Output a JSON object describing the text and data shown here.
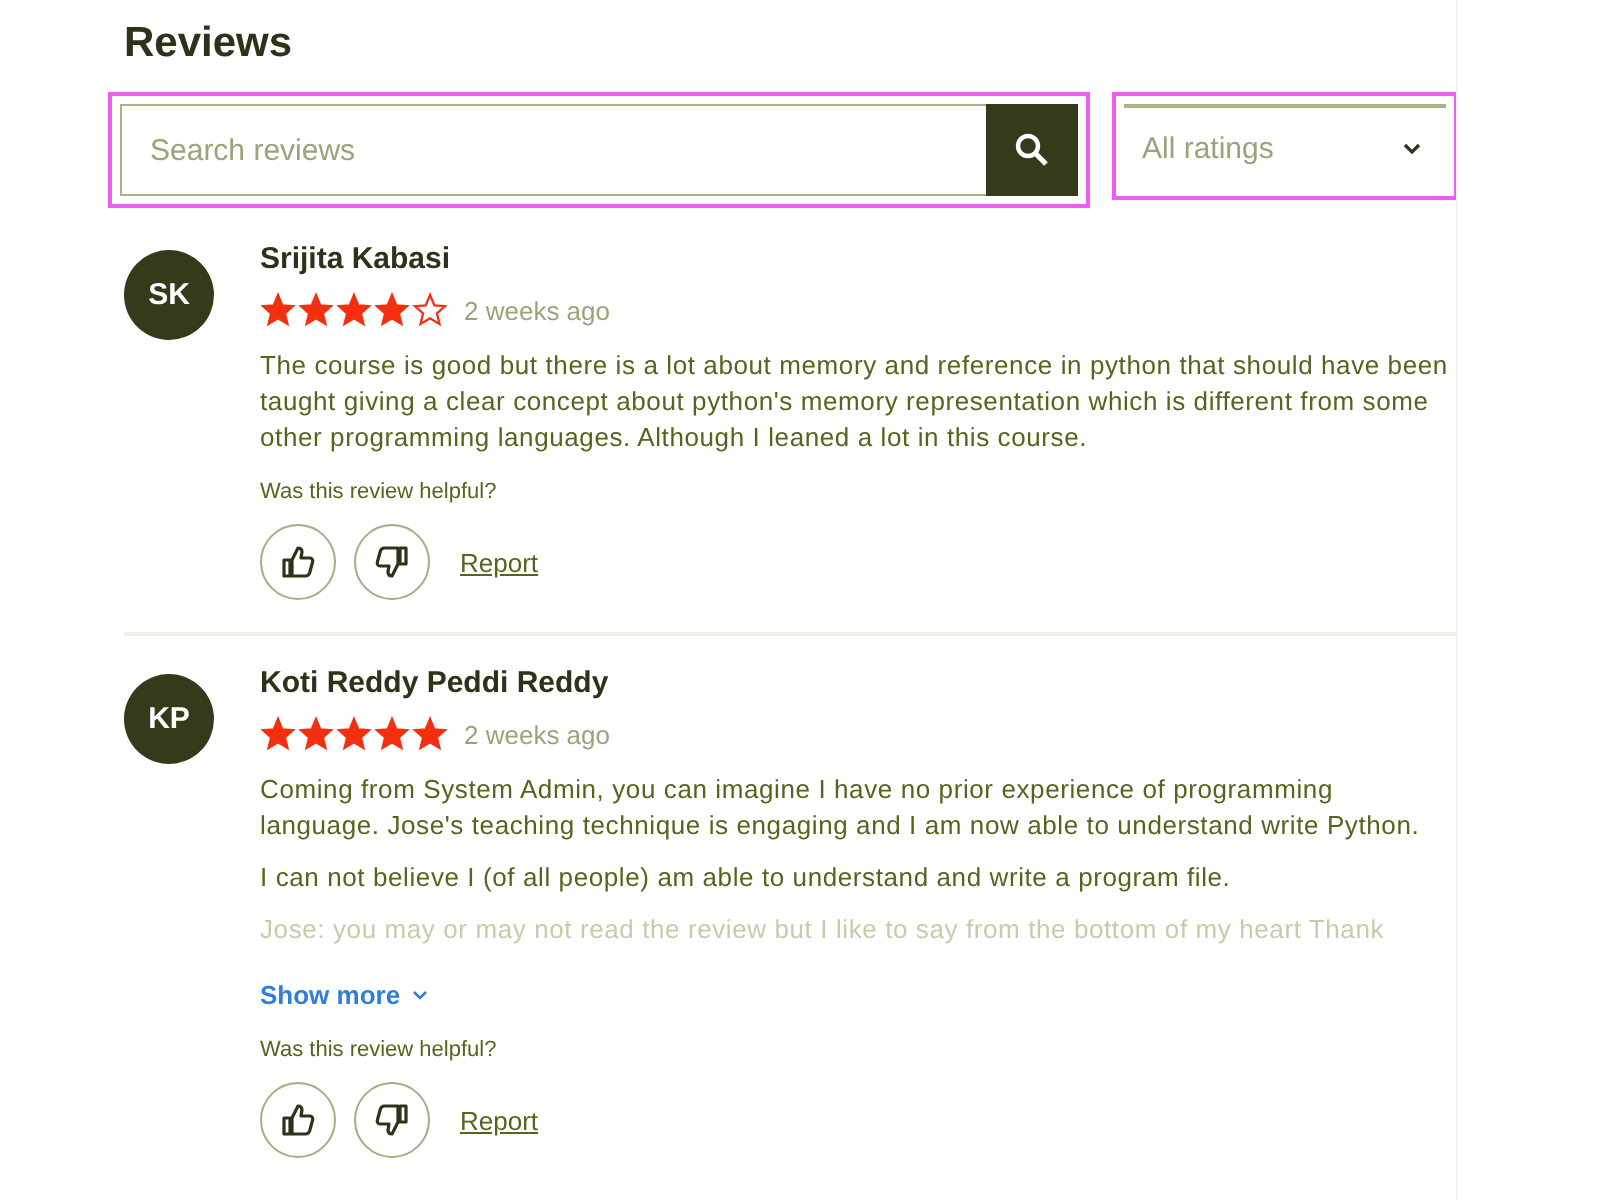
{
  "heading": "Reviews",
  "search": {
    "placeholder": "Search reviews",
    "highlighted": true
  },
  "filter": {
    "value": "All ratings",
    "highlighted": true
  },
  "reviews": [
    {
      "initials": "SK",
      "name": "Srijita Kabasi",
      "stars": 4,
      "time": "2 weeks ago",
      "paragraphs": [
        {
          "text": "The course is good but there is a lot about memory and reference in python that should have been taught giving a clear concept about python's memory representation which is different from some other programming languages. Although I leaned a lot in this course.",
          "faded": false
        }
      ],
      "helpful_prompt": "Was this review helpful?",
      "report": "Report"
    },
    {
      "initials": "KP",
      "name": "Koti Reddy Peddi Reddy",
      "stars": 5,
      "time": "2 weeks ago",
      "paragraphs": [
        {
          "text": "Coming from System Admin, you can imagine I have no prior experience of programming language. Jose's teaching technique is engaging and I am now able to understand write Python.",
          "faded": false
        },
        {
          "text": "I can not believe I (of all people) am able to understand and write a program file.",
          "faded": false
        },
        {
          "text": "Jose: you may or may not read the review but I like to say from the bottom of my heart Thank",
          "faded": true
        }
      ],
      "show_more": "Show more",
      "helpful_prompt": "Was this review helpful?",
      "report": "Report"
    }
  ]
}
